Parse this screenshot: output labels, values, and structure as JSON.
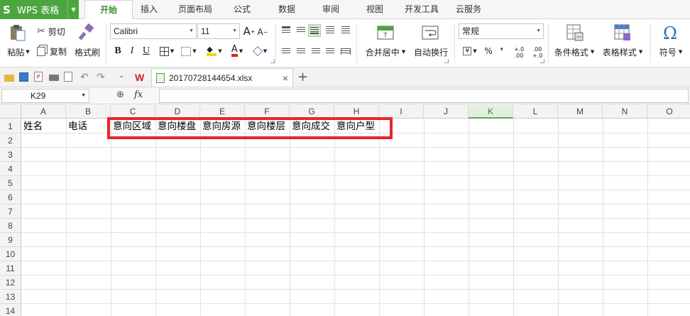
{
  "app": {
    "name": "WPS 表格",
    "logo_glyph": "S"
  },
  "menu_tabs": [
    "开始",
    "插入",
    "页面布局",
    "公式",
    "数据",
    "审阅",
    "视图",
    "开发工具",
    "云服务"
  ],
  "active_tab": "开始",
  "ribbon": {
    "paste_label": "粘贴",
    "cut_label": "剪切",
    "copy_label": "复制",
    "format_painter_label": "格式刷",
    "font_name": "Calibri",
    "font_size": "11",
    "bold": "B",
    "italic": "I",
    "underline": "U",
    "merge_center_label": "合并居中",
    "wrap_text_label": "自动换行",
    "number_format": "常规",
    "percent": "%",
    "comma": "❜",
    "inc_decimal": "+.0\n.00",
    "dec_decimal": ".00\n+.0",
    "conditional_format_label": "条件格式",
    "table_style_label": "表格样式",
    "symbol_label": "符号",
    "symbol_glyph": "Ω"
  },
  "document": {
    "filename": "20170728144654.xlsx",
    "close": "×",
    "new_tab": "+"
  },
  "formula_bar": {
    "name_box": "K29",
    "fx": "fx",
    "formula": ""
  },
  "sheet": {
    "columns": [
      "A",
      "B",
      "C",
      "D",
      "E",
      "F",
      "G",
      "H",
      "I",
      "J",
      "K",
      "L",
      "M",
      "N",
      "O"
    ],
    "selected_column": "K",
    "rows": [
      "1",
      "2",
      "3",
      "4",
      "5",
      "6",
      "7",
      "8",
      "9",
      "10",
      "11",
      "12",
      "13",
      "14"
    ],
    "row1": {
      "A": "姓名",
      "B": "电话",
      "C": "意向区域",
      "D": "意向楼盘",
      "E": "意向房源",
      "F": "意向楼层",
      "G": "意向成交",
      "H": "意向户型"
    }
  },
  "colors": {
    "accent_green": "#4da540",
    "highlight_red": "#e8232e"
  }
}
